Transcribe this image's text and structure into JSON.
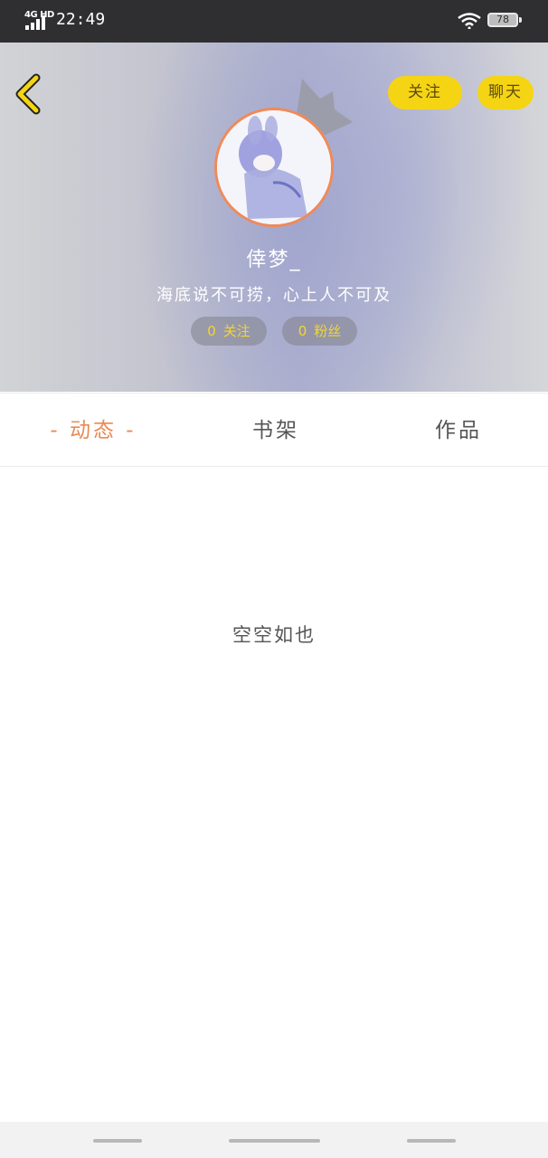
{
  "status_bar": {
    "network": "4G HD",
    "time": "22:49",
    "battery": "78"
  },
  "header": {
    "follow_label": "关注",
    "chat_label": "聊天",
    "username": "倖梦_",
    "bio": "海底说不可捞，心上人不可及",
    "following_count": "0",
    "following_label": "关注",
    "fans_count": "0",
    "fans_label": "粉丝"
  },
  "tabs": {
    "dynamics": "- 动态 -",
    "bookshelf": "书架",
    "works": "作品"
  },
  "content": {
    "empty_text": "空空如也"
  },
  "colors": {
    "accent": "#e98a55",
    "button_yellow": "#f5d414",
    "status_bar": "#2f2f31"
  },
  "icons": [
    "back-chevron-icon",
    "wifi-icon",
    "signal-icon",
    "battery-icon",
    "crown-icon"
  ]
}
